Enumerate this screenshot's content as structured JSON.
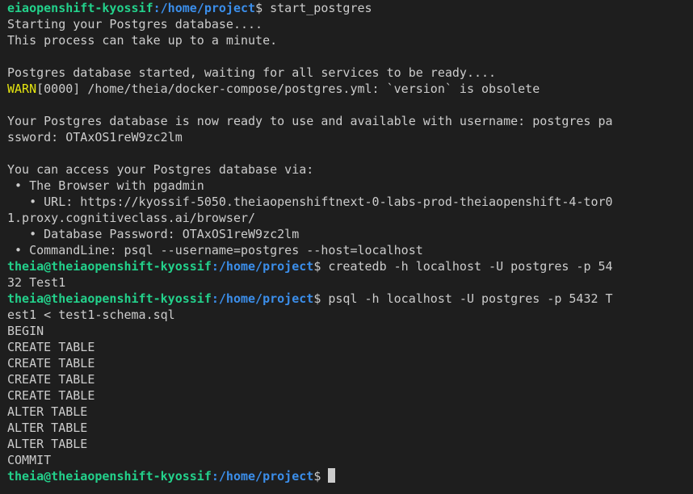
{
  "colors": {
    "background": "#1e1e1e",
    "text": "#cccccc",
    "prompt_user": "#23d18b",
    "prompt_path": "#3b8eea",
    "warn": "#e5e510"
  },
  "lines": [
    {
      "user": "eiaopenshift-kyossif",
      "path": ":/home/project",
      "sym": "$",
      "text": " start_postgres"
    },
    {
      "text": "Starting your Postgres database...."
    },
    {
      "text": "This process can take up to a minute."
    },
    {
      "text": ""
    },
    {
      "text": "Postgres database started, waiting for all services to be ready...."
    },
    {
      "warn": "WARN",
      "text": "[0000] /home/theia/docker-compose/postgres.yml: `version` is obsolete"
    },
    {
      "text": ""
    },
    {
      "text": "Your Postgres database is now ready to use and available with username: postgres pa"
    },
    {
      "text": "ssword: OTAxOS1reW9zc2lm"
    },
    {
      "text": ""
    },
    {
      "text": "You can access your Postgres database via:"
    },
    {
      "text": " • The Browser with pgadmin"
    },
    {
      "text": "   • URL: https://kyossif-5050.theiaopenshiftnext-0-labs-prod-theiaopenshift-4-tor0"
    },
    {
      "text": "1.proxy.cognitiveclass.ai/browser/"
    },
    {
      "text": "   • Database Password: OTAxOS1reW9zc2lm"
    },
    {
      "text": " • CommandLine: psql --username=postgres --host=localhost"
    },
    {
      "user": "theia@theiaopenshift-kyossif",
      "path": ":/home/project",
      "sym": "$",
      "text": " createdb -h localhost -U postgres -p 54"
    },
    {
      "text": "32 Test1"
    },
    {
      "user": "theia@theiaopenshift-kyossif",
      "path": ":/home/project",
      "sym": "$",
      "text": " psql -h localhost -U postgres -p 5432 T"
    },
    {
      "text": "est1 < test1-schema.sql"
    },
    {
      "text": "BEGIN"
    },
    {
      "text": "CREATE TABLE"
    },
    {
      "text": "CREATE TABLE"
    },
    {
      "text": "CREATE TABLE"
    },
    {
      "text": "CREATE TABLE"
    },
    {
      "text": "ALTER TABLE"
    },
    {
      "text": "ALTER TABLE"
    },
    {
      "text": "ALTER TABLE"
    },
    {
      "text": "COMMIT"
    },
    {
      "user": "theia@theiaopenshift-kyossif",
      "path": ":/home/project",
      "sym": "$",
      "text": " ",
      "cursor": true
    }
  ]
}
